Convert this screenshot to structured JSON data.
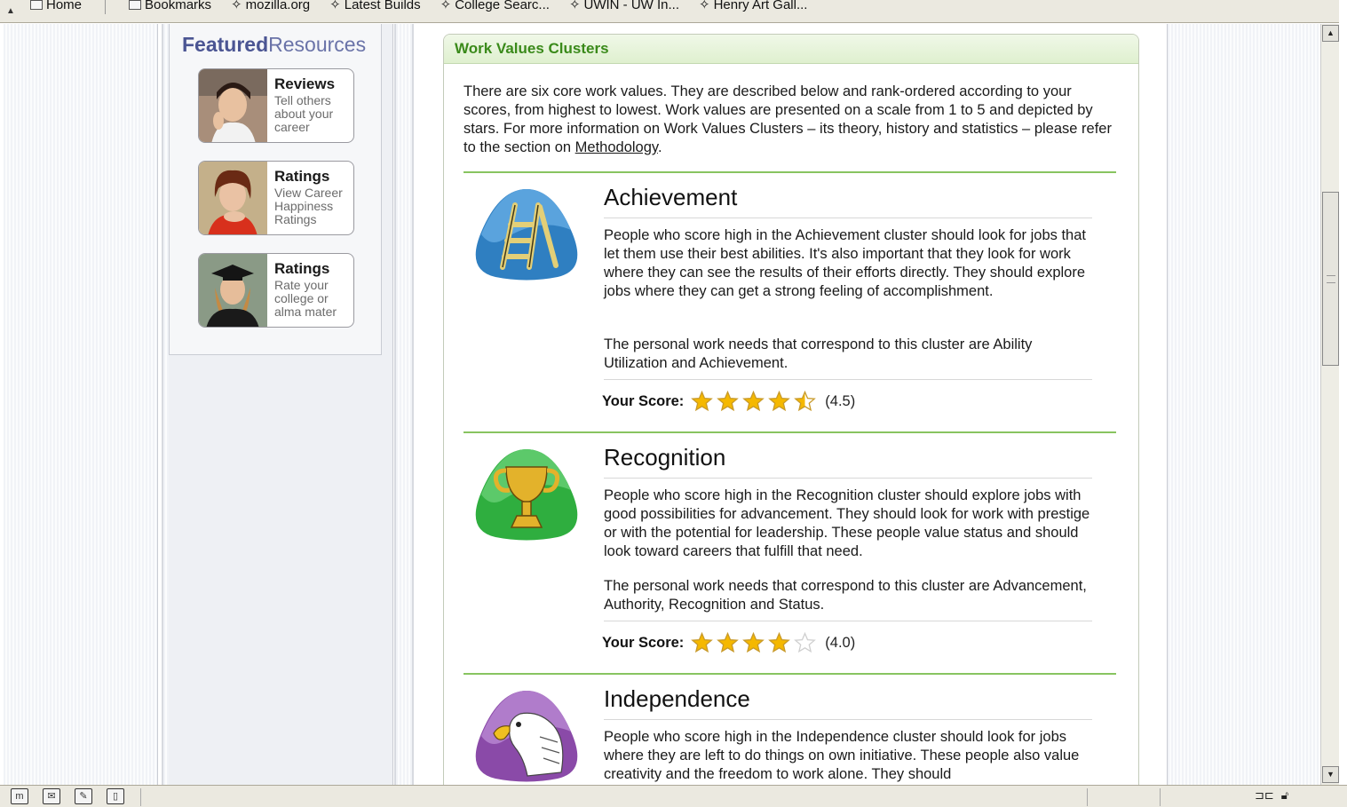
{
  "bookmarks": [
    {
      "label": "Home",
      "icon": "home-icon"
    },
    {
      "label": "Bookmarks",
      "icon": "folder-icon"
    },
    {
      "label": "mozilla.org",
      "icon": "bookmark-icon"
    },
    {
      "label": "Latest Builds",
      "icon": "bookmark-icon"
    },
    {
      "label": "College Searc...",
      "icon": "bookmark-icon"
    },
    {
      "label": "UWIN - UW In...",
      "icon": "bookmark-icon"
    },
    {
      "label": "Henry Art Gall...",
      "icon": "bookmark-icon"
    }
  ],
  "sidebar": {
    "title_bold": "Featured",
    "title_light": "Resources",
    "resources": [
      {
        "title": "Reviews",
        "desc": "Tell others about your career"
      },
      {
        "title": "Ratings",
        "desc": "View Career Happiness Ratings"
      },
      {
        "title": "Ratings",
        "desc": "Rate your college or alma mater"
      }
    ]
  },
  "main": {
    "header": "Work Values Clusters",
    "intro": "There are six core work values. They are described below and rank-ordered according to your scores, from highest to lowest. Work values are presented on a scale from 1 to 5 and depicted by stars. For more information on Work Values Clusters – its theory, history and statistics – please refer to the section on ",
    "intro_link": "Methodology",
    "intro_end": ".",
    "score_label": "Your Score:",
    "clusters": [
      {
        "title": "Achievement",
        "icon": "ladder-icon",
        "desc": "People who score high in the Achievement cluster should look for jobs that let them use their best abilities. It's also important that they look for work where they can see the results of their efforts directly. They should explore jobs where they can get a strong feeling of accomplishment.",
        "needs": "The personal work needs that correspond to this cluster are Ability Utilization and Achievement.",
        "score": 4.5,
        "score_text": "(4.5)"
      },
      {
        "title": "Recognition",
        "icon": "trophy-icon",
        "desc": "People who score high in the Recognition cluster should explore jobs with good possibilities for advancement. They should look for work with prestige or with the potential for leadership. These people value status and should look toward careers that fulfill that need.",
        "needs": "The personal work needs that correspond to this cluster are Advancement, Authority, Recognition and Status.",
        "score": 4.0,
        "score_text": "(4.0)"
      },
      {
        "title": "Independence",
        "icon": "eagle-icon",
        "desc": "People who score high in the Independence cluster should look for jobs where they are left to do things on own initiative. These people also value creativity and the freedom to work alone. They should"
      }
    ]
  },
  "colors": {
    "accent_green": "#3a8a1a",
    "rule_green": "#88c460",
    "star_gold": "#f5b800",
    "featured_blue": "#6a73a8"
  }
}
